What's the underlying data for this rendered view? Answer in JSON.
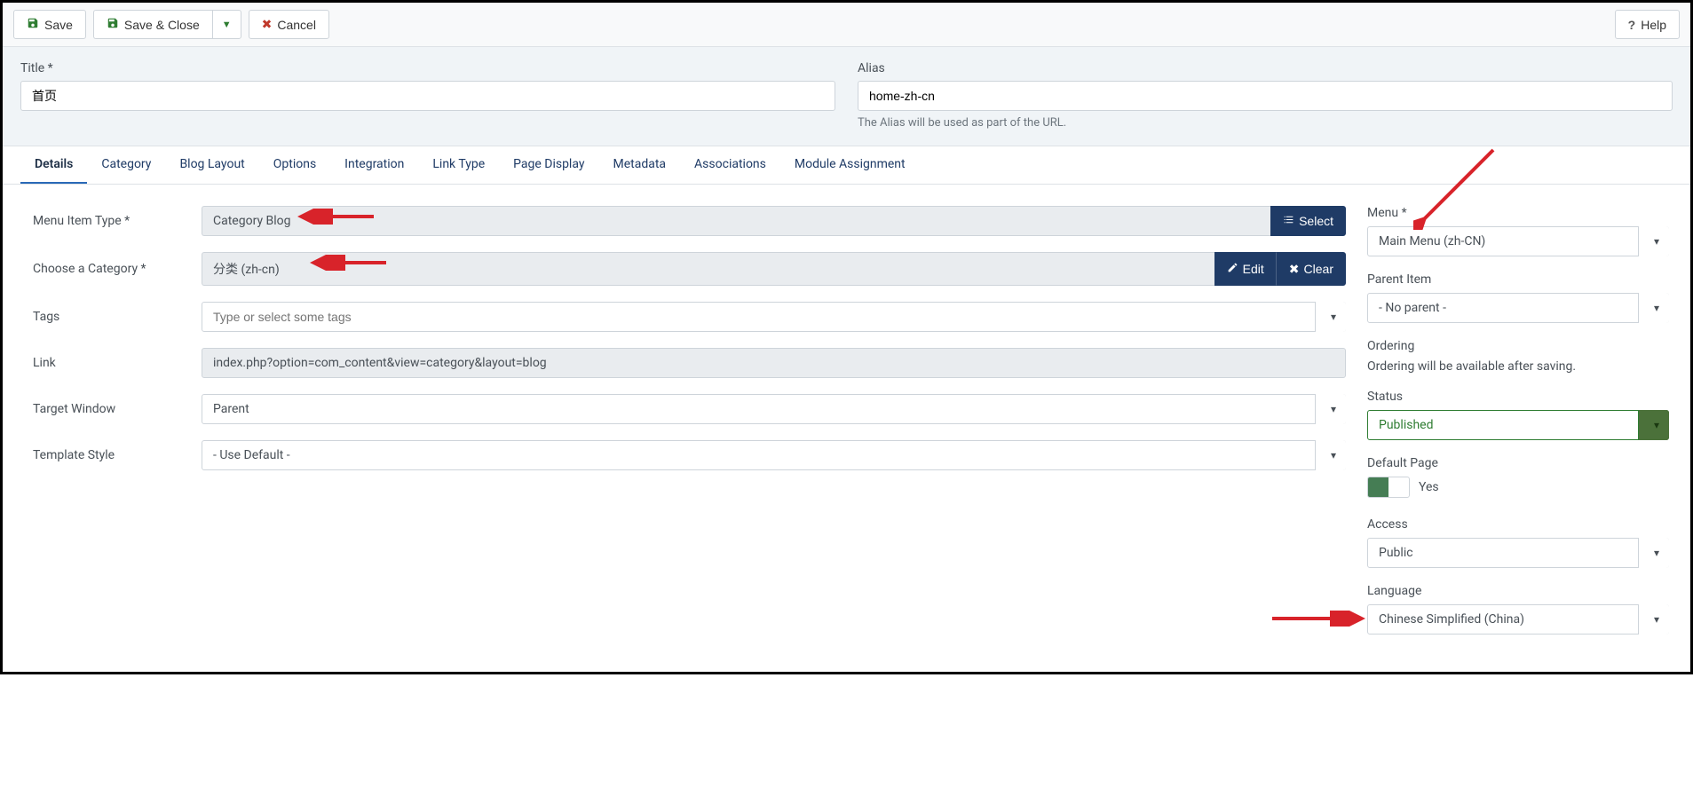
{
  "toolbar": {
    "save": "Save",
    "save_close": "Save & Close",
    "cancel": "Cancel",
    "help": "Help"
  },
  "header": {
    "title_label": "Title *",
    "title_value": "首页",
    "alias_label": "Alias",
    "alias_value": "home-zh-cn",
    "alias_help": "The Alias will be used as part of the URL."
  },
  "tabs": [
    "Details",
    "Category",
    "Blog Layout",
    "Options",
    "Integration",
    "Link Type",
    "Page Display",
    "Metadata",
    "Associations",
    "Module Assignment"
  ],
  "main": {
    "menu_item_type_label": "Menu Item Type *",
    "menu_item_type_value": "Category Blog",
    "select_btn": "Select",
    "choose_category_label": "Choose a Category *",
    "choose_category_value": "分类 (zh-cn)",
    "edit_btn": "Edit",
    "clear_btn": "Clear",
    "tags_label": "Tags",
    "tags_placeholder": "Type or select some tags",
    "link_label": "Link",
    "link_value": "index.php?option=com_content&view=category&layout=blog",
    "target_window_label": "Target Window",
    "target_window_value": "Parent",
    "template_style_label": "Template Style",
    "template_style_value": "- Use Default -"
  },
  "side": {
    "menu_label": "Menu *",
    "menu_value": "Main Menu (zh-CN)",
    "parent_item_label": "Parent Item",
    "parent_item_value": "- No parent -",
    "ordering_label": "Ordering",
    "ordering_text": "Ordering will be available after saving.",
    "status_label": "Status",
    "status_value": "Published",
    "default_page_label": "Default Page",
    "default_page_value": "Yes",
    "access_label": "Access",
    "access_value": "Public",
    "language_label": "Language",
    "language_value": "Chinese Simplified (China)"
  }
}
